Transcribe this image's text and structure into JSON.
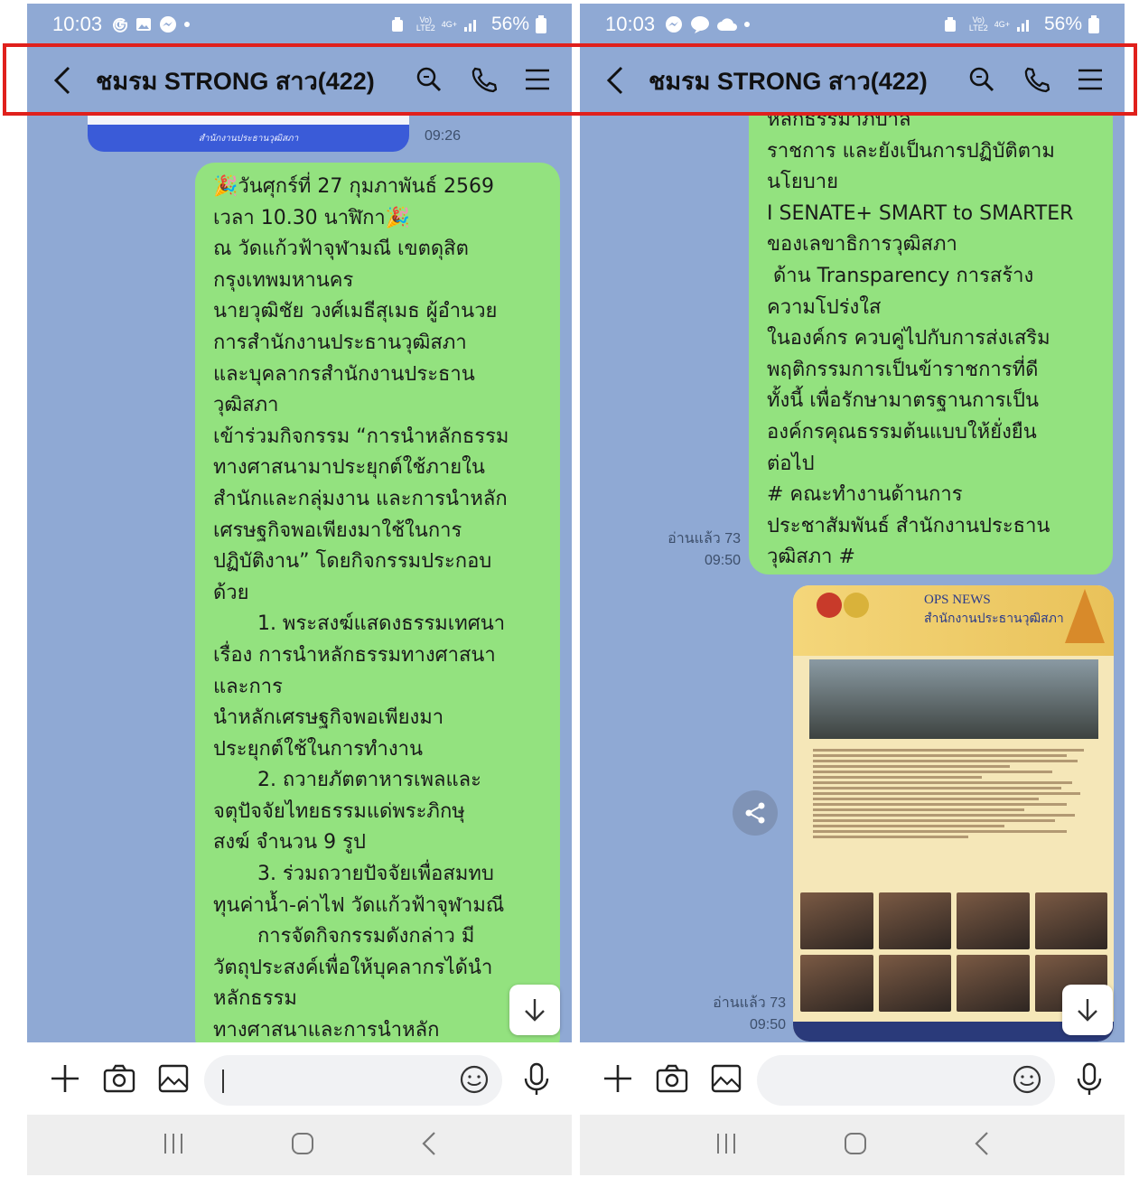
{
  "status_left": {
    "time": "10:03",
    "battery": "56%",
    "network_vol": "Vo)",
    "network_lte": "LTE2",
    "network_4g": "4G+"
  },
  "status_right": {
    "time": "10:03",
    "battery": "56%",
    "network_vol": "Vo)",
    "network_lte": "LTE2",
    "network_4g": "4G+"
  },
  "appbar": {
    "title": "ชมรม STRONG สาว(422)"
  },
  "left_chat": {
    "prev_image_caption": "สำนักงานประธานวุฒิสภา",
    "prev_time": "09:26",
    "message_text": "🎉วันศุกร์ที่ 27 กุมภาพันธ์ 2569\nเวลา 10.30 นาฬิกา🎉\nณ วัดแก้วฟ้าจุฬามณี เขตดุสิต\nกรุงเทพมหานคร\nนายวุฒิชัย วงศ์เมธีสุเมธ ผู้อำนวย\nการสำนักงานประธานวุฒิสภา\nและบุคลากรสำนักงานประธาน\nวุฒิสภา\nเข้าร่วมกิจกรรม “การนำหลักธรรม\nทางศาสนามาประยุกต์ใช้ภายใน\nสำนักและกลุ่มงาน และการนำหลัก\nเศรษฐกิจพอเพียงมาใช้ในการ\nปฏิบัติงาน” โดยกิจกรรมประกอบ\nด้วย\n       1. พระสงฆ์แสดงธรรมเทศนา\nเรื่อง การนำหลักธรรมทางศาสนา\nและการ\nนำหลักเศรษฐกิจพอเพียงมา\nประยุกต์ใช้ในการทำงาน\n       2. ถวายภัตตาหารเพลและ\nจตุปัจจัยไทยธรรมแด่พระภิกษุ\nสงฆ์ จำนวน 9 รูป\n       3. ร่วมถวายปัจจัยเพื่อสมทบ\nทุนค่าน้ำ-ค่าไฟ วัดแก้วฟ้าจุฬามณี\n       การจัดกิจกรรมดังกล่าว มี\nวัตถุประสงค์เพื่อให้บุคลากรได้นำ\nหลักธรรม\nทางศาสนาและการนำหลัก"
  },
  "right_chat": {
    "message_text": "หลักธรรมาภิบาล\nราชการ และยังเป็นการปฏิบัติตาม\nนโยบาย\nI SENATE+ SMART to SMARTER\nของเลขาธิการวุฒิสภา\n ด้าน Transparency การสร้าง\nความโปร่งใส\nในองค์กร ควบคู่ไปกับการส่งเสริม\nพฤติกรรมการเป็นข้าราชการที่ดี\nทั้งนี้ เพื่อรักษามาตรฐานการเป็น\nองค์กรคุณธรรมต้นแบบให้ยั่งยืน\nต่อไป\n# คณะทำงานด้านการ\nประชาสัมพันธ์ สำนักงานประธาน\nวุฒิสภา #",
    "read_1": "อ่านแล้ว 73",
    "time_1": "09:50",
    "read_2": "อ่านแล้ว 73",
    "time_2": "09:50",
    "poster_title": "OPS NEWS",
    "poster_subtitle": "สำนักงานประธานวุฒิสภา"
  },
  "icons": {
    "back": "chevron-left-icon",
    "search": "search-icon",
    "call": "phone-icon",
    "menu": "hamburger-menu-icon",
    "add": "plus-icon",
    "camera": "camera-icon",
    "gallery": "image-icon",
    "emoji": "emoji-icon",
    "mic": "microphone-icon",
    "scroll_down": "arrow-down-icon",
    "share": "share-icon"
  },
  "colors": {
    "chat_bg": "#8fa9d4",
    "bubble": "#93e27f",
    "highlight": "#e0201c"
  }
}
